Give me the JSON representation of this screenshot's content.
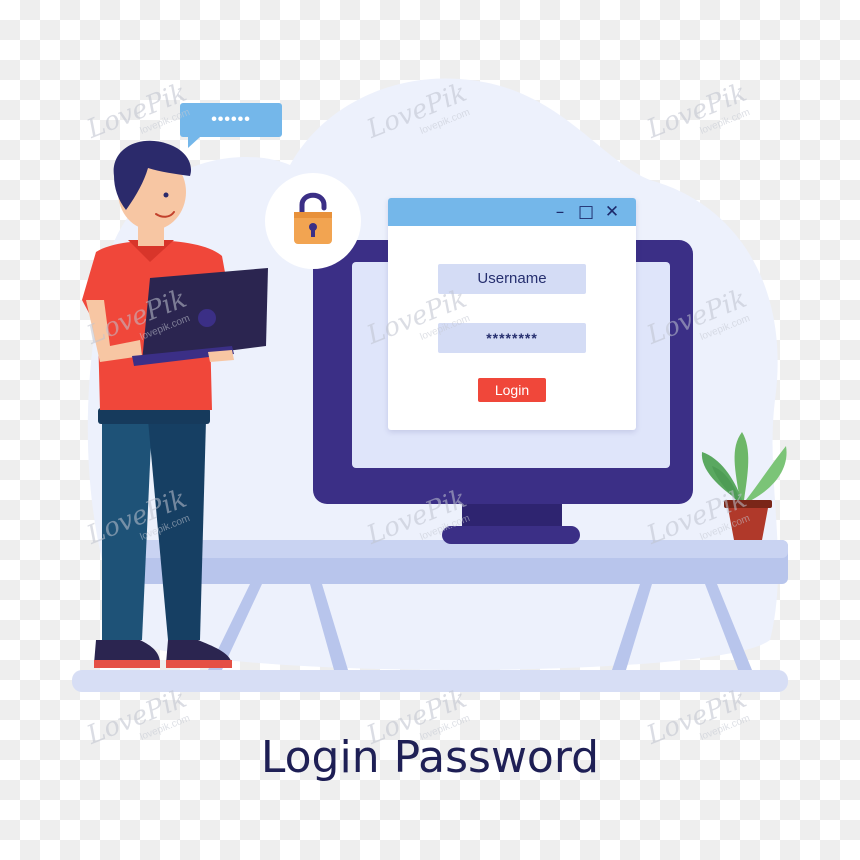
{
  "illustration": {
    "caption": "Login Password",
    "login_window": {
      "username_text": "Username",
      "password_text": "********",
      "login_button": "Login"
    },
    "speech_bubble_text": "••••••",
    "lock_state": "unlocked"
  },
  "watermark": {
    "logo_text": "LovePik",
    "site_text": "lovepik.com"
  },
  "colors": {
    "blob": "#edf1fc",
    "monitor_frame": "#3b2f86",
    "monitor_screen": "#dfe5fa",
    "window_bar": "#74b7ea",
    "field_fill": "#d4dcf5",
    "login_button": "#f0473a",
    "shirt": "#f0473a",
    "pants": "#1e5277",
    "lock": "#f2a451",
    "caption_text": "#1e1f55"
  },
  "icons": [
    "unlocked-padlock-icon",
    "window-minimize-icon",
    "window-maximize-icon",
    "window-close-icon"
  ]
}
